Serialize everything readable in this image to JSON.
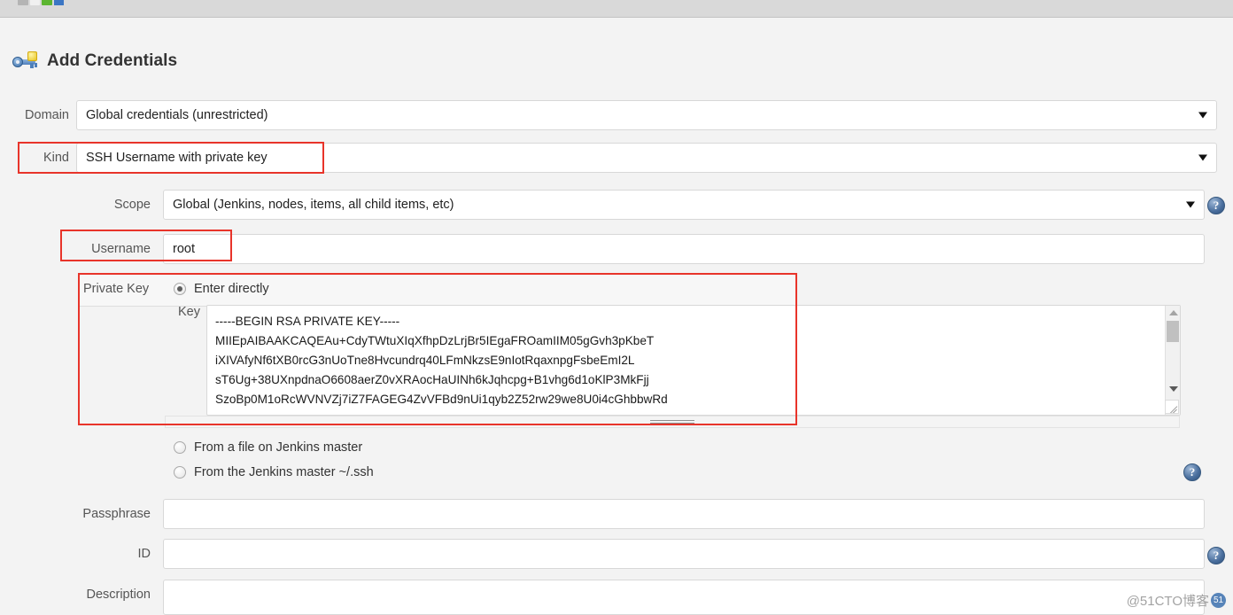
{
  "window": {
    "title": "Add Credentials",
    "heading_icon": "key-icon"
  },
  "form": {
    "domain": {
      "label": "Domain",
      "value": "Global credentials (unrestricted)",
      "options": [
        "Global credentials (unrestricted)"
      ]
    },
    "kind": {
      "label": "Kind",
      "value": "SSH Username with private key",
      "options": [
        "SSH Username with private key"
      ],
      "highlighted": true
    },
    "scope": {
      "label": "Scope",
      "value": "Global (Jenkins, nodes, items, all child items, etc)",
      "options": [
        "Global (Jenkins, nodes, items, all child items, etc)"
      ]
    },
    "username": {
      "label": "Username",
      "value": "root",
      "placeholder": "",
      "highlighted": true
    },
    "private_key": {
      "label": "Private Key",
      "highlighted": true,
      "selected_source": "Enter directly",
      "options": [
        {
          "label": "Enter directly",
          "selected": true
        },
        {
          "label": "From a file on Jenkins master",
          "selected": false
        },
        {
          "label": "From the Jenkins master ~/.ssh",
          "selected": false
        }
      ],
      "key_label": "Key",
      "key_value": "-----BEGIN RSA PRIVATE KEY-----\nMIIEpAIBAAKCAQEAu+CdyTWtuXIqXfhpDzLrjBr5IEgaFROamIIM05gGvh3pKbeT\niXIVAfyNf6tXB0rcG3nUoTne8Hvcundrq40LFmNkzsE9nIotRqaxnpgFsbeEmI2L\nsT6Ug+38UXnpdnaO6608aerZ0vXRAocHaUINh6kJqhcpg+B1vhg6d1oKlP3MkFjj\nSzoBp0M1oRcWVNVZj7iZ7FAGEG4ZvVFBd9nUi1qyb2Z52rw29we8U0i4cGhbbwRd"
    },
    "passphrase": {
      "label": "Passphrase",
      "value": "",
      "placeholder": ""
    },
    "id": {
      "label": "ID",
      "value": "",
      "placeholder": ""
    },
    "description": {
      "label": "Description",
      "value": "",
      "placeholder": ""
    }
  },
  "help": {
    "glyph": "?",
    "items": [
      "scope-help",
      "private-key-help",
      "id-help"
    ]
  },
  "watermark": {
    "text": "@51CTO博客",
    "badge": "51"
  },
  "colors": {
    "page_bg": "#f3f3f3",
    "annotation_red": "#e8342a",
    "help_blue": "#4a6f9e",
    "field_border": "#d8d8d8",
    "label_text": "#555555"
  }
}
